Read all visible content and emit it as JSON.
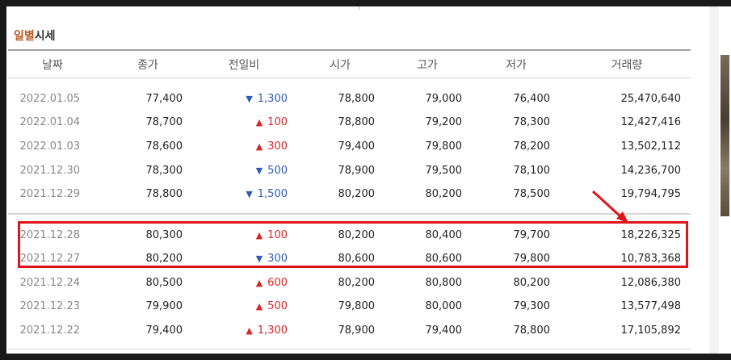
{
  "section_title": {
    "highlight": "일별",
    "rest": "시세"
  },
  "columns": [
    "날짜",
    "종가",
    "전일비",
    "시가",
    "고가",
    "저가",
    "거래량"
  ],
  "colors": {
    "up": "#d8262a",
    "down": "#2e5db8",
    "annotation": "#e0151b",
    "title_accent": "#c0571f"
  },
  "rows": [
    {
      "date": "2022.01.05",
      "close": "77,400",
      "dir": "down",
      "change": "1,300",
      "open": "78,800",
      "high": "79,000",
      "low": "76,400",
      "volume": "25,470,640"
    },
    {
      "date": "2022.01.04",
      "close": "78,700",
      "dir": "up",
      "change": "100",
      "open": "78,800",
      "high": "79,200",
      "low": "78,300",
      "volume": "12,427,416"
    },
    {
      "date": "2022.01.03",
      "close": "78,600",
      "dir": "up",
      "change": "300",
      "open": "79,400",
      "high": "79,800",
      "low": "78,200",
      "volume": "13,502,112"
    },
    {
      "date": "2021.12.30",
      "close": "78,300",
      "dir": "down",
      "change": "500",
      "open": "78,900",
      "high": "79,500",
      "low": "78,100",
      "volume": "14,236,700"
    },
    {
      "date": "2021.12.29",
      "close": "78,800",
      "dir": "down",
      "change": "1,500",
      "open": "80,200",
      "high": "80,200",
      "low": "78,500",
      "volume": "19,794,795"
    },
    {
      "date": "2021.12.28",
      "close": "80,300",
      "dir": "up",
      "change": "100",
      "open": "80,200",
      "high": "80,400",
      "low": "79,700",
      "volume": "18,226,325"
    },
    {
      "date": "2021.12.27",
      "close": "80,200",
      "dir": "down",
      "change": "300",
      "open": "80,600",
      "high": "80,600",
      "low": "79,800",
      "volume": "10,783,368"
    },
    {
      "date": "2021.12.24",
      "close": "80,500",
      "dir": "up",
      "change": "600",
      "open": "80,200",
      "high": "80,800",
      "low": "80,200",
      "volume": "12,086,380"
    },
    {
      "date": "2021.12.23",
      "close": "79,900",
      "dir": "up",
      "change": "500",
      "open": "79,800",
      "high": "80,000",
      "low": "79,300",
      "volume": "13,577,498"
    },
    {
      "date": "2021.12.22",
      "close": "79,400",
      "dir": "up",
      "change": "1,300",
      "open": "78,900",
      "high": "79,400",
      "low": "78,800",
      "volume": "17,105,892"
    }
  ],
  "annotation": {
    "icon": "arrow-down-right-icon"
  }
}
